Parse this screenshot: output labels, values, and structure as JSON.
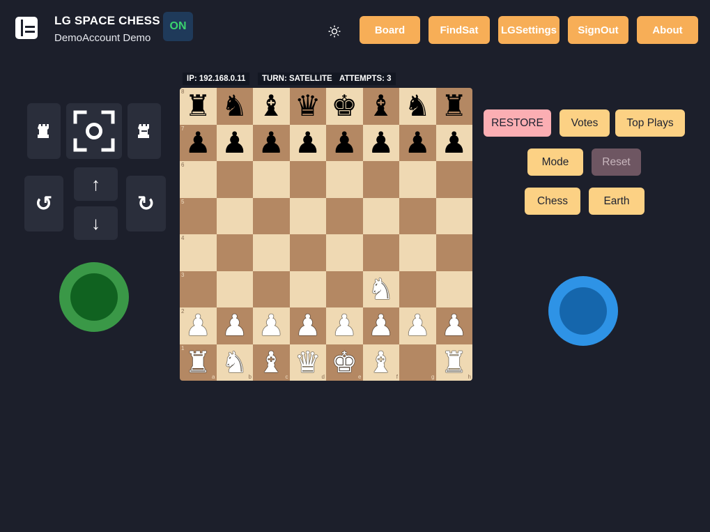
{
  "header": {
    "title": "LG SPACE CHESS",
    "user": "DemoAccount Demo",
    "status": "ON",
    "theme_icon": "sun-icon"
  },
  "nav": {
    "board": "Board",
    "findsat": "FindSat",
    "lgsettings": "LGSettings",
    "signout": "SignOut",
    "about": "About"
  },
  "board_info": {
    "ip": "IP: 192.168.0.11",
    "turn": "TURN: SATELLITE",
    "attempts": "ATTEMPTS: 3"
  },
  "board": {
    "ranks": [
      "8",
      "7",
      "6",
      "5",
      "4",
      "3",
      "2",
      "1"
    ],
    "files": [
      "a",
      "b",
      "c",
      "d",
      "e",
      "f",
      "g",
      "h"
    ],
    "position": [
      [
        "br",
        "bn",
        "bb",
        "bq",
        "bk",
        "bb",
        "bn",
        "br"
      ],
      [
        "bp",
        "bp",
        "bp",
        "bp",
        "bp",
        "bp",
        "bp",
        "bp"
      ],
      [
        "",
        "",
        "",
        "",
        "",
        "",
        "",
        ""
      ],
      [
        "",
        "",
        "",
        "",
        "",
        "",
        "",
        ""
      ],
      [
        "",
        "",
        "",
        "",
        "",
        "",
        "",
        ""
      ],
      [
        "",
        "",
        "",
        "",
        "",
        "wn",
        "",
        ""
      ],
      [
        "wp",
        "wp",
        "wp",
        "wp",
        "wp",
        "wp",
        "wp",
        "wp"
      ],
      [
        "wr",
        "wn",
        "wb",
        "wq",
        "wk",
        "wb",
        "",
        "wr"
      ]
    ]
  },
  "controls": {
    "tilt_left_icon": "rook-small-icon",
    "recenter_icon": "focus-target-icon",
    "tilt_right_icon": "rook-outline-icon",
    "rotate_left": "↺",
    "up": "↑",
    "down": "↓",
    "rotate_right": "↻",
    "left_joystick_color": "#3a9847",
    "right_joystick_color": "#2e93e6"
  },
  "actions": {
    "restore": "RESTORE",
    "votes": "Votes",
    "top_plays": "Top Plays",
    "mode": "Mode",
    "reset": "Reset",
    "chess": "Chess",
    "earth": "Earth"
  },
  "colors": {
    "nav_button": "#f7ae57",
    "action_button": "#fcd184",
    "restore_button": "#fbaeb3",
    "reset_button": "#6e5662",
    "status_on": "#3bd36e"
  }
}
